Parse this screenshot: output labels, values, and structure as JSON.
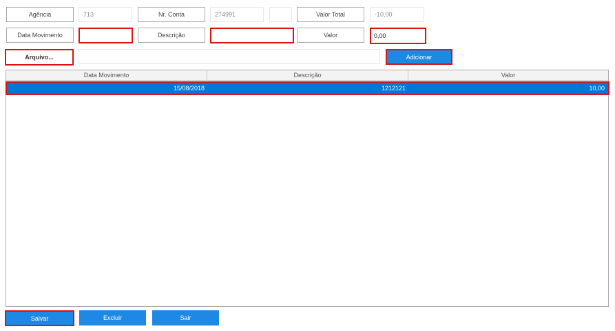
{
  "form": {
    "agencia_label": "Agência",
    "agencia_value": "713",
    "conta_label": "Nr. Conta",
    "conta_value": "274991",
    "conta_digit_value": "",
    "valor_total_label": "Valor Total",
    "valor_total_value": "-10,00",
    "data_movimento_label": "Data Movimento",
    "data_movimento_value": "",
    "descricao_label": "Descrição",
    "descricao_value": "",
    "valor_label": "Valor",
    "valor_value": "0,00",
    "arquivo_label": "Arquivo...",
    "arquivo_path": "",
    "adicionar_label": "Adicionar"
  },
  "grid": {
    "columns": [
      "Data Movimento",
      "Descrição",
      "Valor"
    ],
    "rows": [
      {
        "data_movimento": "15/08/2018",
        "descricao": "1212121",
        "valor": "10,00",
        "selected": true
      }
    ]
  },
  "footer": {
    "salvar_label": "Salvar",
    "excluir_label": "Excluir",
    "sair_label": "Sair"
  },
  "colors": {
    "accent": "#1e88e5",
    "selected_row": "#0078d7",
    "highlight_border": "#dd1111"
  }
}
